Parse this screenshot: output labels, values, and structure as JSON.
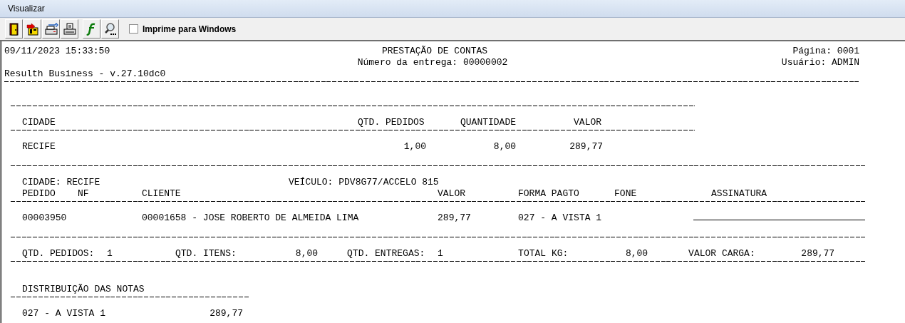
{
  "window": {
    "title": "Visualizar"
  },
  "toolbar": {
    "buttons": [
      {
        "kind": "exit"
      },
      {
        "kind": "export"
      },
      {
        "kind": "printer_setup"
      },
      {
        "kind": "print"
      },
      {
        "kind": "function"
      },
      {
        "kind": "zoom"
      }
    ],
    "checkbox": {
      "label": "Imprime para Windows",
      "checked": false
    }
  },
  "report": {
    "header": {
      "timestamp": "09/11/2023 15:33:50",
      "title": "PRESTAÇÃO DE CONTAS",
      "delivery": "Número da entrega: 00000002",
      "page": "Página: 0001",
      "user": "Usuário: ADMIN",
      "system": "Resulth Business - v.27.10dc0"
    },
    "city_summary": {
      "columns": [
        "CIDADE",
        "QTD. PEDIDOS",
        "QUANTIDADE",
        "VALOR"
      ],
      "rows": [
        [
          "RECIFE",
          "1,00",
          "8,00",
          "289,77"
        ]
      ]
    },
    "detail": {
      "city": "CIDADE: RECIFE",
      "vehicle": "VEÍCULO: PDV8G77/ACCELO 815",
      "columns": [
        "PEDIDO",
        "NF",
        "CLIENTE",
        "VALOR",
        "FORMA PAGTO",
        "FONE",
        "ASSINATURA"
      ],
      "rows": [
        {
          "pedido": "00003950",
          "cliente": "00001658 - JOSE ROBERTO DE ALMEIDA LIMA",
          "valor": "289,77",
          "forma_pagto": "027 - A VISTA 1"
        }
      ]
    },
    "totals": [
      {
        "label": "QTD. PEDIDOS:",
        "value": "1"
      },
      {
        "label": "QTD. ITENS:",
        "value": "8,00"
      },
      {
        "label": "QTD. ENTREGAS:",
        "value": "1"
      },
      {
        "label": "TOTAL KG:",
        "value": "8,00"
      },
      {
        "label": "VALOR CARGA:",
        "value": "289,77"
      }
    ],
    "distribution": {
      "title": "DISTRIBUIÇÃO DAS NOTAS",
      "rows": [
        {
          "label": "027 - A VISTA 1",
          "value": "289,77"
        }
      ]
    }
  }
}
